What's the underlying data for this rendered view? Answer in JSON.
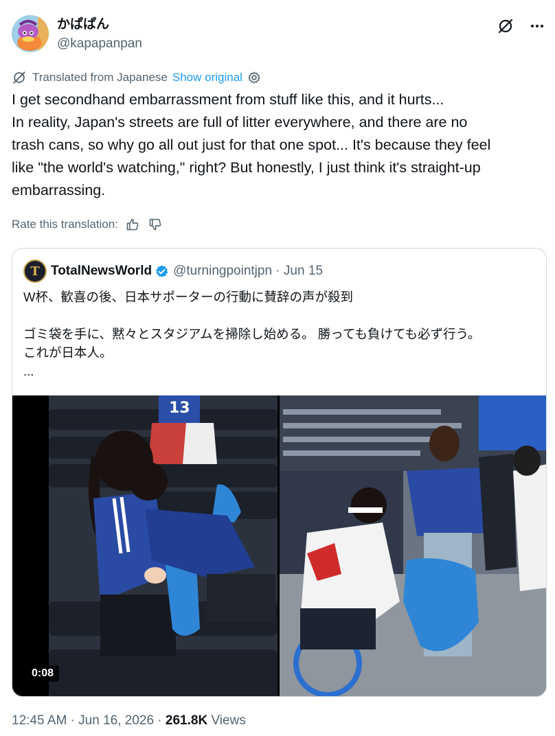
{
  "author": {
    "display_name": "かぱぱん",
    "handle": "@kapapanpan"
  },
  "header_icons": [
    "grok-icon",
    "more-icon"
  ],
  "translation": {
    "notice": "Translated from Japanese",
    "show_original": "Show original"
  },
  "body_lines": [
    "I get secondhand embarrassment from stuff like this, and it hurts...",
    "In reality, Japan's streets are full of litter everywhere, and there are no",
    "trash cans, so why go all out just for that one spot... It's because they feel",
    "like \"the world's watching,\" right? But honestly, I just think it's straight-up",
    "embarrassing."
  ],
  "rate": {
    "label": "Rate this translation:"
  },
  "quote": {
    "avatar_letter": "T",
    "name": "TotalNewsWorld",
    "handle_date": "@turningpointjpn · Jun 15",
    "lines": [
      "W杯、歓喜の後、日本サポーターの行動に賛辞の声が殺到",
      "",
      "ゴミ袋を手に、黙々とスタジアムを掃除し始める。 勝っても負けても必ず行う。",
      "これが日本人。",
      "..."
    ],
    "video_duration": "0:08"
  },
  "footer": {
    "timestamp": "12:45 AM · Jun 16, 2026 · ",
    "views_count": "261.8K",
    "views_label": " Views"
  },
  "colors": {
    "link": "#1d9bf0",
    "secondary_text": "#536471",
    "border": "#cfd9de",
    "bag_blue": "#2f86d6",
    "jersey_blue": "#1e3a8a"
  }
}
